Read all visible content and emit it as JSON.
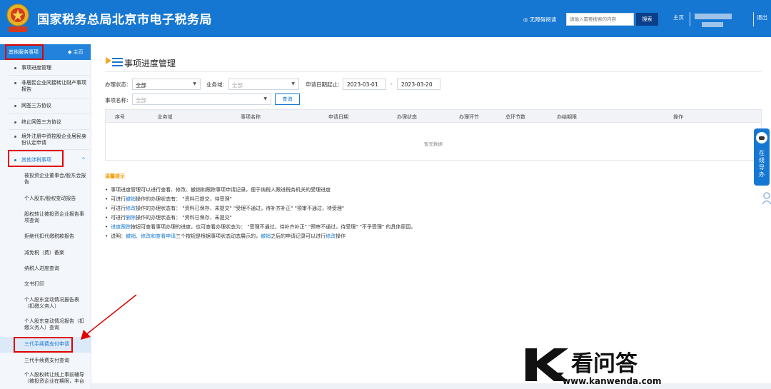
{
  "header": {
    "site_title": "国家税务总局北京市电子税务局",
    "accessibility": "◎ 无障碍阅读",
    "search_placeholder": "请输入需要搜索的内容",
    "search_button": "搜索",
    "home_link": "主页",
    "logout_link": "退出",
    "colors": {
      "bar": "#1677d2",
      "search_button": "#0c3f8a"
    }
  },
  "sidebar": {
    "title": "其他服务事项",
    "home": "◆ 主页",
    "items": [
      {
        "label": "事项进度管理"
      },
      {
        "label": "非居民企业间接转让财产事项报告"
      },
      {
        "label": "网签三方协议"
      },
      {
        "label": "终止网签三方协议"
      },
      {
        "label": "境外注册中资控股企业居民身份认定申请"
      },
      {
        "label": "其他涉税事项"
      }
    ],
    "sub_items": [
      {
        "label": "被投资企业董事会/股东会报告"
      },
      {
        "label": "个人股东/股权变动报告"
      },
      {
        "label": "股权转让被投资企业报告事项查询"
      },
      {
        "label": "拒绝代扣代缴税款报告"
      },
      {
        "label": "减免税（费）备案"
      },
      {
        "label": "纳税人进度查询"
      },
      {
        "label": "文书打印"
      },
      {
        "label": "个人股东变动情况报告表（扣缴义务人）"
      },
      {
        "label": "个人股东变动情况报告（扣缴义务人）查询"
      },
      {
        "label": "三代手续费支付申请"
      },
      {
        "label": "三代手续费支付查询"
      },
      {
        "label": "个人股权转让线上事前辅导（被投资企业在期限，丰台"
      }
    ]
  },
  "main": {
    "title": "事项进度管理",
    "filters": {
      "status_label": "办理状态:",
      "status_value": "全部",
      "domain_label": "业务域:",
      "domain_value": "全部",
      "date_label": "申请日期起止:",
      "date_start": "2023-03-01",
      "date_sep": "-",
      "date_end": "2023-03-20",
      "name_label": "事项名称:",
      "name_value": "全部",
      "query_button": "查询"
    },
    "table": {
      "columns": [
        "序号",
        "业务域",
        "事项名称",
        "申请日期",
        "办理状态",
        "办理环节",
        "总环节数",
        "办结期限",
        "操作"
      ],
      "empty_text": "暂无数据"
    },
    "tips": {
      "title": "温馨提示",
      "lines": [
        [
          "事项进度管理可以进行查看、修改、撤销和跟踪事项申请记录，便于纳税人跟进税务机关的受理进度"
        ],
        [
          "可进行",
          "撤销",
          "操作的办理状态有：  \"资料已提交，待受理\""
        ],
        [
          "可进行",
          "修改",
          "操作的办理状态有：  \"资料已保存，未提交\"  \"受理不通过，待补齐补正\"  \"预审不通过，待受理\""
        ],
        [
          "可进行",
          "删除",
          "操作的办理状态有：  \"资料已保存，未提交\""
        ],
        [
          "",
          "进度跟踪",
          "按钮可查看事项办理的进度，也可查看办理状态为：  \"受理不通过，待补齐补正\"  \"预审不通过，待受理\"  \"不予受理\"  的具体原因。"
        ],
        [
          "说明：",
          "撤销、修改和查看申请",
          "三个按钮是根据事项状态动态展示的，",
          "撤销",
          "之后的申请记录可以进行",
          "修改",
          "操作"
        ]
      ]
    }
  },
  "float_help": {
    "label": "在线导办"
  },
  "watermark": {
    "text": "看问答",
    "url": "www.kanwenda.com"
  }
}
